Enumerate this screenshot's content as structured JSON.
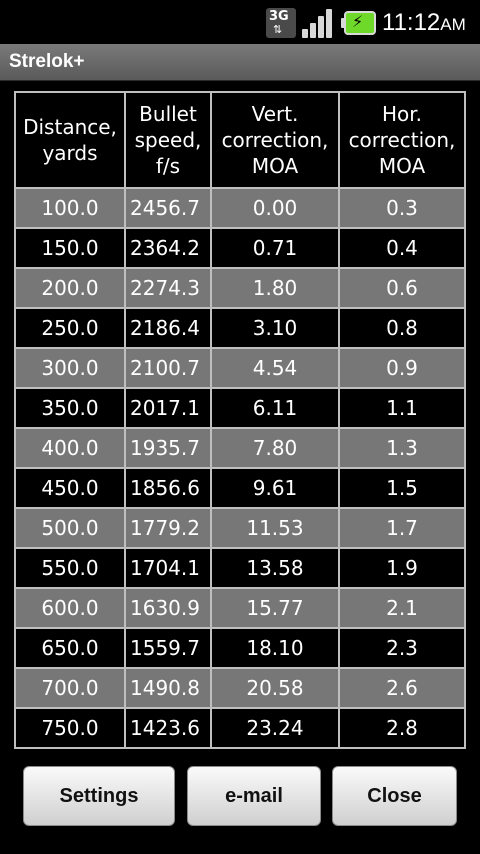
{
  "status_bar": {
    "network": "3G",
    "time": "11:12",
    "ampm": "AM",
    "icons": [
      "3g-data-icon",
      "signal-strength-icon",
      "battery-charging-icon"
    ]
  },
  "app": {
    "title": "Strelok+"
  },
  "table": {
    "headers": [
      [
        "Distance,",
        "yards"
      ],
      [
        "Bullet",
        "speed,",
        "f/s"
      ],
      [
        "Vert.",
        "correction,",
        "MOA"
      ],
      [
        "Hor.",
        "correction,",
        "MOA"
      ]
    ],
    "rows": [
      [
        "100.0",
        "2456.7",
        "0.00",
        "0.3"
      ],
      [
        "150.0",
        "2364.2",
        "0.71",
        "0.4"
      ],
      [
        "200.0",
        "2274.3",
        "1.80",
        "0.6"
      ],
      [
        "250.0",
        "2186.4",
        "3.10",
        "0.8"
      ],
      [
        "300.0",
        "2100.7",
        "4.54",
        "0.9"
      ],
      [
        "350.0",
        "2017.1",
        "6.11",
        "1.1"
      ],
      [
        "400.0",
        "1935.7",
        "7.80",
        "1.3"
      ],
      [
        "450.0",
        "1856.6",
        "9.61",
        "1.5"
      ],
      [
        "500.0",
        "1779.2",
        "11.53",
        "1.7"
      ],
      [
        "550.0",
        "1704.1",
        "13.58",
        "1.9"
      ],
      [
        "600.0",
        "1630.9",
        "15.77",
        "2.1"
      ],
      [
        "650.0",
        "1559.7",
        "18.10",
        "2.3"
      ],
      [
        "700.0",
        "1490.8",
        "20.58",
        "2.6"
      ],
      [
        "750.0",
        "1423.6",
        "23.24",
        "2.8"
      ]
    ]
  },
  "buttons": {
    "settings": "Settings",
    "email": "e-mail",
    "close": "Close"
  },
  "colors": {
    "odd_row": "#777777",
    "even_row": "#000000",
    "grid": "#bfbfbf",
    "battery": "#6fd92a"
  }
}
